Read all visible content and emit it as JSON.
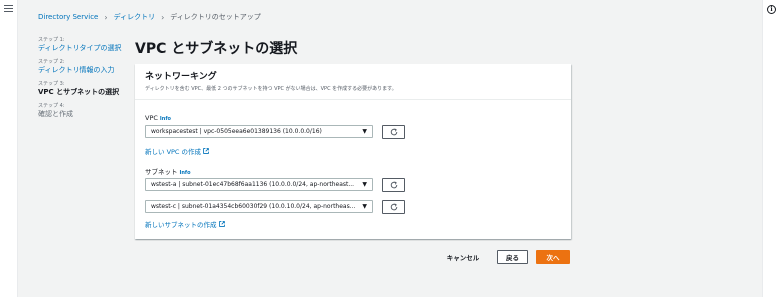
{
  "breadcrumb": {
    "items": [
      "Directory Service",
      "ディレクトリ",
      "ディレクトリのセットアップ"
    ]
  },
  "steps": [
    {
      "num": "ステップ 1:",
      "label": "ディレクトリタイプの選択",
      "state": "link"
    },
    {
      "num": "ステップ 2:",
      "label": "ディレクトリ情報の入力",
      "state": "link"
    },
    {
      "num": "ステップ 3:",
      "label": "VPC とサブネットの選択",
      "state": "active"
    },
    {
      "num": "ステップ 4:",
      "label": "確認と作成",
      "state": "disabled"
    }
  ],
  "page_title": "VPC とサブネットの選択",
  "panel": {
    "title": "ネットワーキング",
    "description": "ディレクトリを含む VPC、最低 2 つのサブネットを持つ VPC がない場合は、VPC を作成する必要があります。",
    "vpc_label": "VPC",
    "vpc_info": "Info",
    "vpc_value": "workspacestest | vpc-0505eea6e01389136 (10.0.0.0/16)",
    "create_vpc_link": "新しい VPC の作成",
    "subnet_label": "サブネット",
    "subnet_info": "Info",
    "subnet_1": "wstest-a | subnet-01ec47b68f6aa1136 (10.0.0.0/24, ap-northeast...",
    "subnet_2": "wstest-c | subnet-01a4354cb60030f29 (10.0.10.0/24, ap-northeas...",
    "create_subnet_link": "新しいサブネットの作成"
  },
  "footer": {
    "cancel": "キャンセル",
    "back": "戻る",
    "next": "次へ"
  },
  "colors": {
    "link": "#0073bb",
    "primary": "#ec7211",
    "background": "#f2f3f3"
  },
  "icons": {
    "menu": "menu-icon",
    "info": "info-icon",
    "refresh": "refresh-icon",
    "external": "external-link-icon",
    "caret": "caret-down-icon"
  }
}
